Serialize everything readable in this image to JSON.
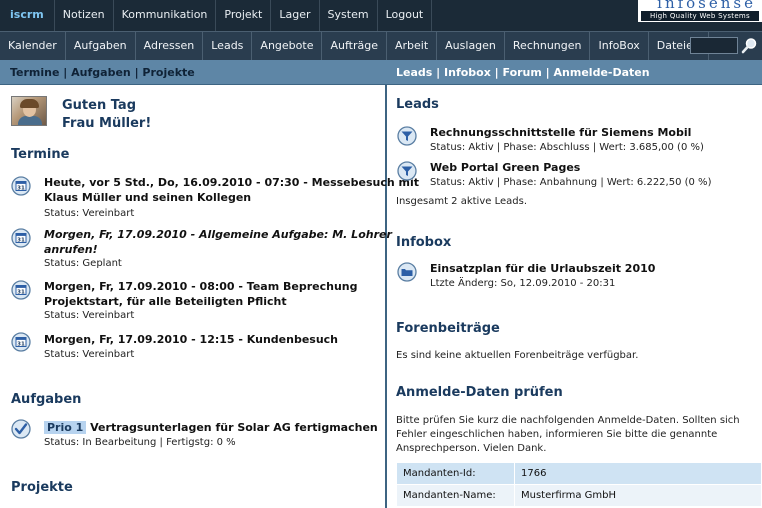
{
  "topnav": {
    "brand": "iscrm",
    "items": [
      "Notizen",
      "Kommunikation",
      "Projekt",
      "Lager",
      "System",
      "Logout"
    ],
    "logo_text": "infosense",
    "logo_tagline": "High Quality Web Systems"
  },
  "subnav": {
    "items": [
      "Kalender",
      "Aufgaben",
      "Adressen",
      "Leads",
      "Angebote",
      "Aufträge",
      "Arbeit",
      "Auslagen",
      "Rechnungen",
      "InfoBox",
      "Dateien"
    ],
    "search_value": ""
  },
  "header": {
    "left": [
      "Termine",
      "Aufgaben",
      "Projekte"
    ],
    "right": [
      "Leads",
      "Infobox",
      "Forum",
      "Anmelde-Daten"
    ],
    "separator": " | "
  },
  "greeting": {
    "line1": "Guten Tag",
    "line2": "Frau Müller!"
  },
  "termine": {
    "title": "Termine",
    "items": [
      {
        "line1": "Heute, vor 5 Std., Do, 16.09.2010 - 07:30 - Messebesuch mit",
        "line2": "Klaus Müller und seinen Kollegen",
        "status": "Status: Vereinbart"
      },
      {
        "line1": "Morgen, Fr, 17.09.2010 - Allgemeine Aufgabe: M. Lohrer",
        "line2": "anrufen!",
        "status": "Status: Geplant"
      },
      {
        "line1": "Morgen, Fr, 17.09.2010 - 08:00 - Team Beprechung",
        "line2": "Projektstart, für alle Beteiligten Pflicht",
        "status": "Status: Vereinbart"
      },
      {
        "line1": "Morgen, Fr, 17.09.2010 - 12:15 - Kundenbesuch",
        "line2": "",
        "status": "Status: Vereinbart"
      }
    ],
    "icon_label": "31"
  },
  "aufgaben": {
    "title": "Aufgaben",
    "prio": "Prio 1",
    "task": " Vertragsunterlagen für Solar AG fertigmachen",
    "status": "Status: In Bearbeitung | Fertigstg: 0 %"
  },
  "projekte": {
    "title": "Projekte"
  },
  "leads": {
    "title": "Leads",
    "items": [
      {
        "title": "Rechnungsschnittstelle für Siemens Mobil",
        "status": "Status: Aktiv | Phase: Abschluss | Wert: 3.685,00 (0 %)"
      },
      {
        "title": "Web Portal Green Pages",
        "status": "Status: Aktiv | Phase: Anbahnung | Wert: 6.222,50 (0 %)"
      }
    ],
    "summary": "Insgesamt 2 aktive Leads."
  },
  "infobox": {
    "title": "Infobox",
    "item_title": "Einsatzplan für die Urlaubszeit 2010",
    "item_meta": "Ltzte Änderg: So, 12.09.2010 - 20:31"
  },
  "forum": {
    "title": "Forenbeiträge",
    "text": "Es sind keine aktuellen Forenbeiträge verfügbar."
  },
  "anmelde": {
    "title": "Anmelde-Daten prüfen",
    "text_lines": [
      "Bitte prüfen Sie kurz die nachfolgenden Anmelde-Daten. Sollten sich",
      "Fehler eingeschlichen haben, informieren Sie bitte die genannte",
      "Ansprechperson. Vielen Dank."
    ],
    "rows": [
      {
        "label": "Mandanten-Id:",
        "value": "1766"
      },
      {
        "label": "Mandanten-Name:",
        "value": "Musterfirma GmbH"
      }
    ]
  },
  "colors": {
    "topbar": "#1b2a37",
    "subbar": "#2a3d4f",
    "header_strip": "#5e86a6",
    "heading": "#1a3a5e",
    "brand": "#7fc6f2"
  }
}
